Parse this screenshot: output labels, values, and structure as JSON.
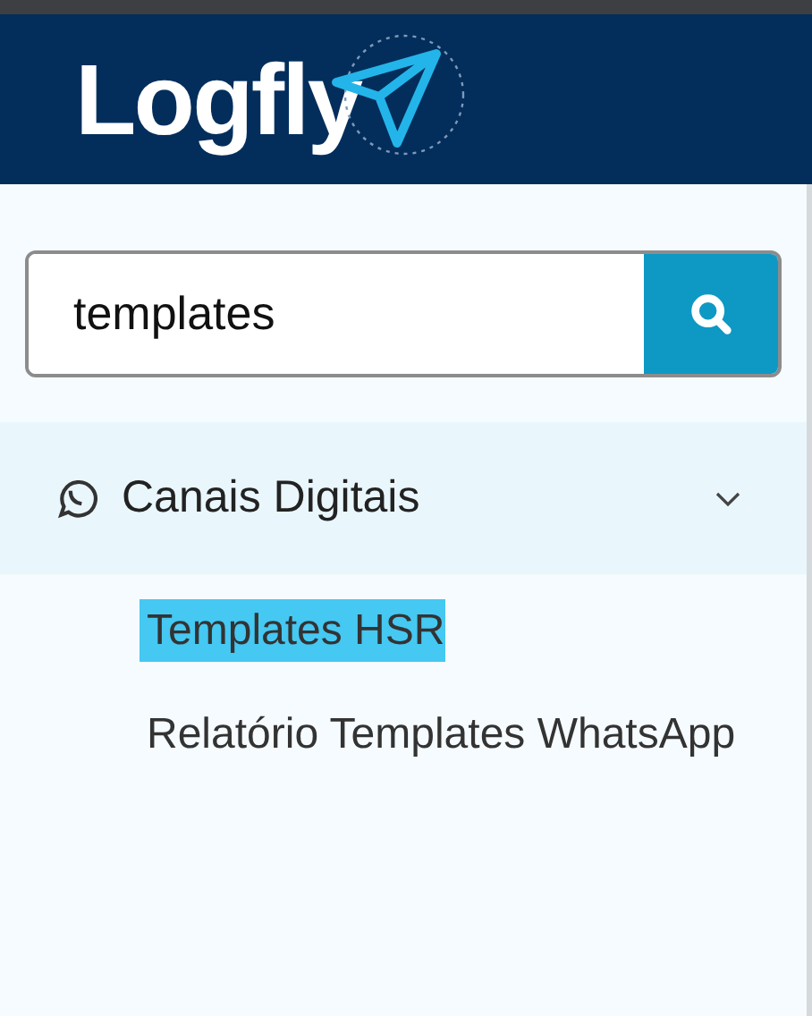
{
  "header": {
    "logo_text": "Logfly"
  },
  "search": {
    "value": "templates"
  },
  "menu": [
    {
      "label": "Canais Digitais",
      "expanded": true,
      "children": [
        {
          "label": "Templates HSR",
          "selected": true
        },
        {
          "label": "Relatório Templates WhatsApp",
          "selected": false
        }
      ]
    }
  ]
}
